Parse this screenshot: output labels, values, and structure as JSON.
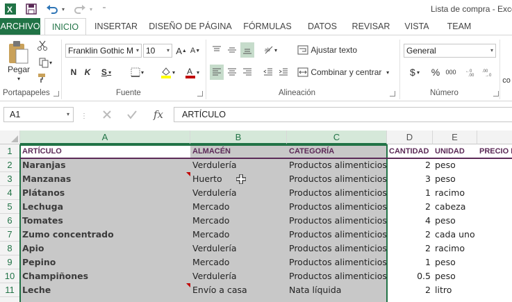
{
  "window": {
    "title": "Lista de compra - Exce"
  },
  "ribbon_tabs": [
    "ARCHIVO",
    "INICIO",
    "INSERTAR",
    "DISEÑO DE PÁGINA",
    "FÓRMULAS",
    "DATOS",
    "REVISAR",
    "VISTA",
    "TEAM"
  ],
  "clipboard": {
    "paste_label": "Pegar",
    "group_label": "Portapapeles"
  },
  "font": {
    "name": "Franklin Gothic M",
    "size": "10",
    "group_label": "Fuente",
    "bold": "N",
    "italic": "K",
    "underline": "S"
  },
  "alignment": {
    "wrap_text": "Ajustar texto",
    "merge_center": "Combinar y centrar",
    "group_label": "Alineación"
  },
  "number": {
    "format": "General",
    "group_label": "Número",
    "percent": "%",
    "thousands": "000",
    "currency": "$"
  },
  "styles": {
    "partial_label": "co"
  },
  "formula_bar": {
    "name_box": "A1",
    "fx": "fx",
    "content": "ARTÍCULO"
  },
  "columns": [
    "A",
    "B",
    "C",
    "D",
    "E"
  ],
  "rows": [
    "1",
    "2",
    "3",
    "4",
    "5",
    "6",
    "7",
    "8",
    "9",
    "10",
    "11"
  ],
  "headers": {
    "a": "ARTÍCULO",
    "b": "ALMACÉN",
    "c": "CATEGORÍA",
    "d": "CANTIDAD",
    "e": "UNIDAD",
    "f": "PRECIO I"
  },
  "data": [
    {
      "a": "Naranjas",
      "b": "Verdulería",
      "c": "Productos  alimenticios",
      "d": "2",
      "e": "peso"
    },
    {
      "a": "Manzanas",
      "b": "Huerto",
      "c": "Productos  alimenticios",
      "d": "3",
      "e": "peso"
    },
    {
      "a": "Plátanos",
      "b": "Verdulería",
      "c": "Productos  alimenticios",
      "d": "1",
      "e": "racimo"
    },
    {
      "a": "Lechuga",
      "b": "Mercado",
      "c": "Productos  alimenticios",
      "d": "2",
      "e": "cabeza"
    },
    {
      "a": "Tomates",
      "b": "Mercado",
      "c": "Productos  alimenticios",
      "d": "4",
      "e": "peso"
    },
    {
      "a": "Zumo  concentrado",
      "b": "Mercado",
      "c": "Productos  alimenticios",
      "d": "2",
      "e": "cada  uno"
    },
    {
      "a": "Apio",
      "b": "Verdulería",
      "c": "Productos  alimenticios",
      "d": "2",
      "e": "racimo"
    },
    {
      "a": "Pepino",
      "b": "Mercado",
      "c": "Productos  alimenticios",
      "d": "1",
      "e": "peso"
    },
    {
      "a": "Champiñones",
      "b": "Verdulería",
      "c": "Productos  alimenticios",
      "d": "0.5",
      "e": "peso"
    },
    {
      "a": "Leche",
      "b": "Envío  a  casa",
      "c": "Nata  líquida",
      "d": "2",
      "e": "litro"
    }
  ],
  "colors": {
    "accent": "#217346",
    "header_text": "#5b2a57",
    "selection": "#c8c8c8",
    "comment": "#c00000"
  }
}
